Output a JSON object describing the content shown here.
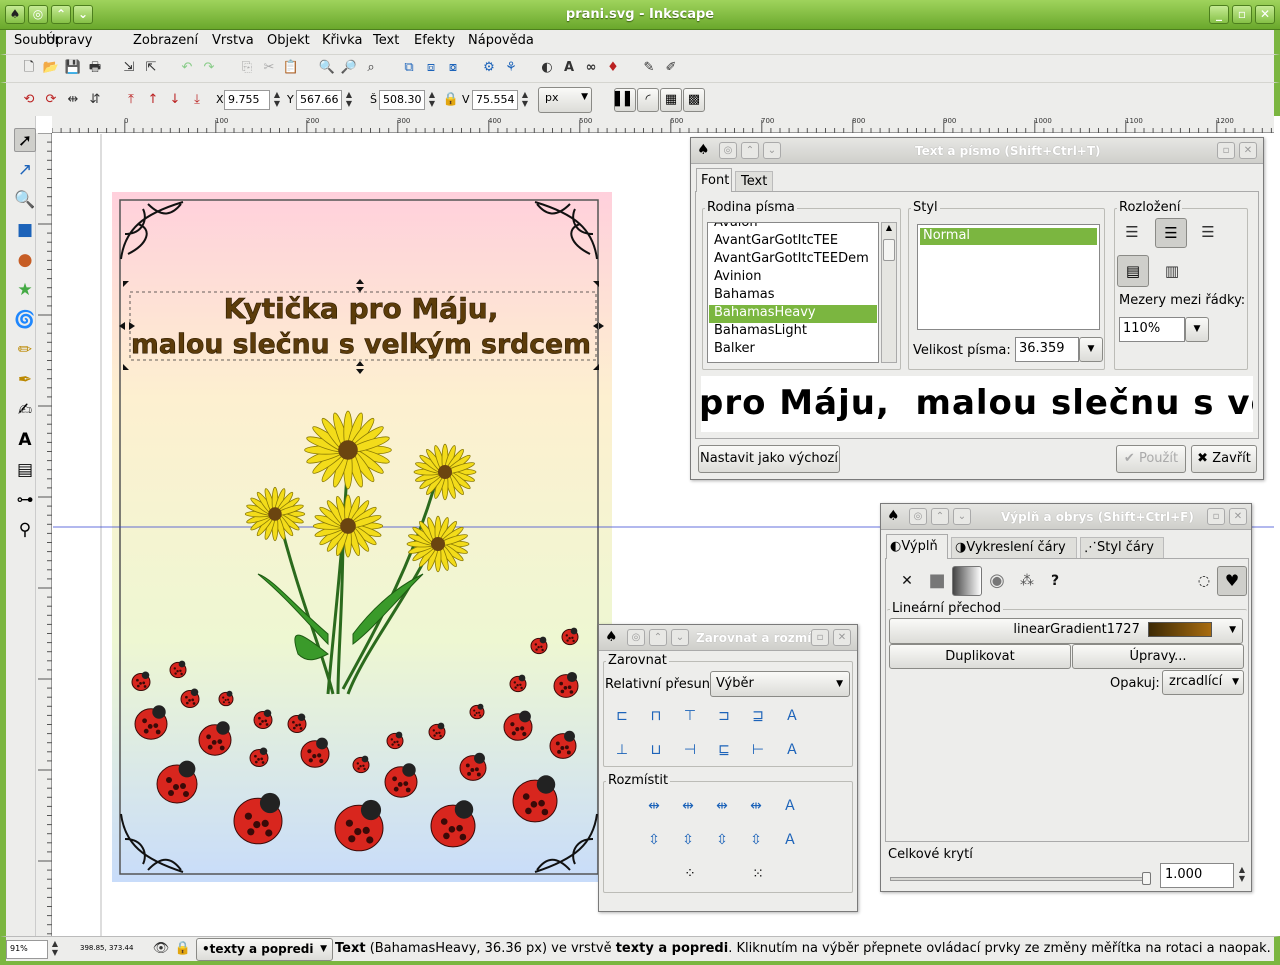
{
  "window": {
    "title": "prani.svg - Inkscape"
  },
  "menu": [
    "Soubor",
    "Úpravy",
    "Zobrazení",
    "Vrstva",
    "Objekt",
    "Křivka",
    "Text",
    "Efekty",
    "Nápověda"
  ],
  "toolbar2": {
    "x_label": "X",
    "x_value": "9.755",
    "y_label": "Y",
    "y_value": "567.66",
    "w_label": "Š",
    "w_value": "508.30",
    "h_label": "V",
    "h_value": "75.554",
    "unit": "px"
  },
  "ruler": {
    "h_ticks": [
      "0",
      "100",
      "200",
      "300",
      "400",
      "500",
      "600",
      "700",
      "800",
      "900",
      "1000",
      "1100",
      "1200"
    ]
  },
  "card": {
    "title_line1": "Kytička pro Máju,",
    "title_line2": "malou slečnu s velkým srdcem"
  },
  "text_dialog": {
    "title": "Text a písmo (Shift+Ctrl+T)",
    "tabs": [
      "Font",
      "Text"
    ],
    "family_label": "Rodina písma",
    "families": [
      "Avalon",
      "AvantGarGotItcTEE",
      "AvantGarGotItcTEEDem",
      "Avinion",
      "Bahamas",
      "BahamasHeavy",
      "BahamasLight",
      "Balker"
    ],
    "selected_family": "BahamasHeavy",
    "style_label": "Styl",
    "styles": [
      "Normal"
    ],
    "size_label": "Velikost písma:",
    "size_value": "36.359",
    "layout_label": "Rozložení",
    "spacing_label": "Mezery mezi řádky:",
    "spacing_value": "110%",
    "preview": "pro Máju,  malou slečnu s velkým",
    "default_button": "Nastavit jako výchozí",
    "apply_button": "Použít",
    "close_button": "Zavřít"
  },
  "fill_dialog": {
    "title": "Výplň a obrys (Shift+Ctrl+F)",
    "tabs": [
      "Výplň",
      "Vykreslení čáry",
      "Styl čáry"
    ],
    "gradient_label": "Lineární přechod",
    "gradient_name": "linearGradient1727",
    "duplicate_button": "Duplikovat",
    "edit_button": "Úpravy...",
    "repeat_label": "Opakuj:",
    "repeat_value": "zrcadlící",
    "opacity_label": "Celkové krytí",
    "opacity_value": "1.000",
    "opacity_level": 1.0,
    "gradient_colors": [
      "#3d2a05",
      "#a86c10"
    ]
  },
  "align_dialog": {
    "title": "Zarovnat a rozmís",
    "align_label": "Zarovnat",
    "relative_label": "Relativní přesun:",
    "relative_value": "Výběr",
    "distribute_label": "Rozmístit"
  },
  "status": {
    "zoom": "91%",
    "coords": "398.85, 373.44",
    "layer": "•texty a popredi",
    "msg_bold1": "Text",
    "msg1": " (BahamasHeavy, 36.36 px) ve vrstvě ",
    "msg_bold2": "texty a popredi",
    "msg2": ". Kliknutím na výběr přepnete ovládací prvky ze změny měřítka na rotaci a naopak."
  },
  "colors": {
    "accent": "#7bb640",
    "selection": "#7bb640"
  }
}
